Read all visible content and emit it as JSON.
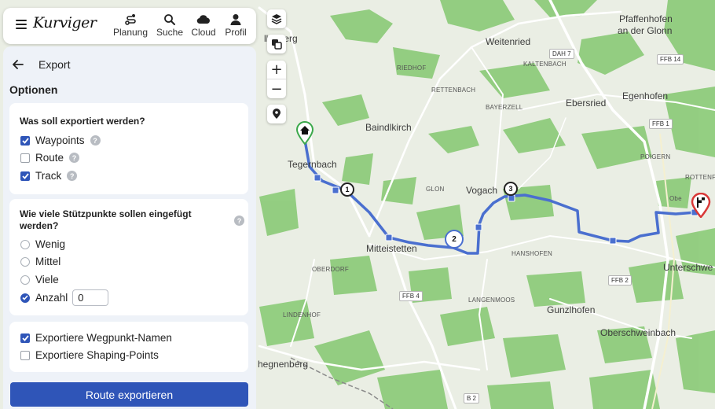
{
  "app": {
    "logo": "Kurviger"
  },
  "nav": {
    "planning": "Planung",
    "search": "Suche",
    "cloud": "Cloud",
    "profile": "Profil"
  },
  "panel": {
    "title": "Export",
    "section_title": "Optionen",
    "export_question": "Was soll exportiert werden?",
    "export_options": [
      {
        "label": "Waypoints",
        "checked": true
      },
      {
        "label": "Route",
        "checked": false
      },
      {
        "label": "Track",
        "checked": true
      }
    ],
    "points_question": "Wie viele Stützpunkte sollen eingefügt werden?",
    "points_options": [
      {
        "label": "Wenig",
        "selected": false
      },
      {
        "label": "Mittel",
        "selected": false
      },
      {
        "label": "Viele",
        "selected": false
      },
      {
        "label": "Anzahl",
        "selected": true
      }
    ],
    "count_value": "0",
    "extra_options": [
      {
        "label": "Exportiere Wegpunkt-Namen",
        "checked": true
      },
      {
        "label": "Exportiere Shaping-Points",
        "checked": false
      }
    ],
    "export_button": "Route exportieren"
  },
  "map": {
    "towns": [
      "Pfaffenhofen",
      "an der Glonn",
      "Weitenried",
      "Ebersried",
      "Egenhofen",
      "Baindlkirch",
      "Tegernbach",
      "Vogach",
      "Mitteistetten",
      "Gunzlhofen",
      "Oberschweinbach",
      "Unterschwe",
      "hegnenberg",
      "Obe",
      "llenberg"
    ],
    "villages": [
      "KALTENBACH",
      "RIEDHOF",
      "RETTENBACH",
      "BAYERZELL",
      "GLON",
      "OBERDORF",
      "HANSHOFEN",
      "LANGENMOOS",
      "LINDENHOF",
      "POIGERN",
      "ROTTENFUL"
    ],
    "road_signs": [
      "DAH 7",
      "FFB 14",
      "FFB 1",
      "FFB 4",
      "FFB 2",
      "B 2"
    ],
    "waypoints": [
      "1",
      "2",
      "3"
    ],
    "colors": {
      "route": "#4a6fcf",
      "accent": "#2f55b8",
      "forest": "#8fcf7c",
      "start": "#3aa84a",
      "end": "#d93838"
    }
  }
}
